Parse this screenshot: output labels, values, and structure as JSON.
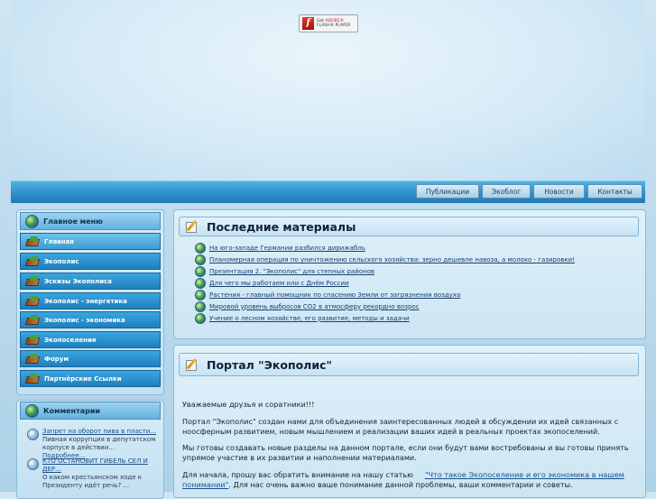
{
  "flash": {
    "line1_prefix": "Get",
    "line1_brand": "ADOBE®",
    "line2": "FLASH® PLAYER"
  },
  "nav": {
    "items": [
      "Публикации",
      "Экоблог",
      "Новости",
      "Контакты"
    ]
  },
  "sidebar": {
    "title": "Главное меню",
    "items": [
      "Главная",
      "Экополис",
      "Эскизы Экополиса",
      "Экополис - энергетика",
      "Экополис - экономика",
      "Экопоселения",
      "Форум",
      "Партнёрские Ссылки"
    ]
  },
  "comments": {
    "title": "Комментарии",
    "items": [
      {
        "link": "Запрет на оборот пива в пласти...",
        "text": "Пивная коррупция в депутатском корпусе в действии...",
        "more": "Подробнее..."
      },
      {
        "link": "КТО ОСТАНОВИТ ГИБЕЛЬ СЕЛ И ДЕР...",
        "text": "О каком крестьянском ходе к Президенту идёт речь? ..."
      }
    ]
  },
  "latest": {
    "title": "Последние материалы",
    "items": [
      "На юго-западе Германии разбился дирижабль",
      "Планомерная операция по уничтожению сельского хозяйства: зерно дешевле навоза, а молоко - газировки!",
      "Презентация 2. \"Экополис\" для степных районов",
      "Для чего мы работаем или с Днём России",
      "Растения - главный помощник по спасению Земли от загрязнения воздуха",
      "Мировой уровень выбросов CO2 в атмосферу рекордно возрос",
      "Учение о лесном хозяйстве, его развитие, методы и задачи"
    ]
  },
  "portal": {
    "title": "Портал \"Экополис\"",
    "p1": "Уважаемые друзья и соратники!!!",
    "p2": "Портал \"Экополис\" создан нами для объединения заинтересованных людей в обсуждении их идей связанных с ноосферным развитием, новым мышлением и реализации ваших идей в реальных проектах экопоселений.",
    "p3": "Мы готовы создавать новые разделы на данном портале, если они будут вами востребованы и вы готовы принять упрямое участие в их развитии и наполнении материалами.",
    "p4_start": "Для начала, прошу вас обратить внимание на нашу статью",
    "p4_link": "\"Что такое Экопоселение и его экономика в нашем понимании\"",
    "p4_end": ". Для нас очень важно ваше понимание данной проблемы, ваши комментарии и советы."
  }
}
